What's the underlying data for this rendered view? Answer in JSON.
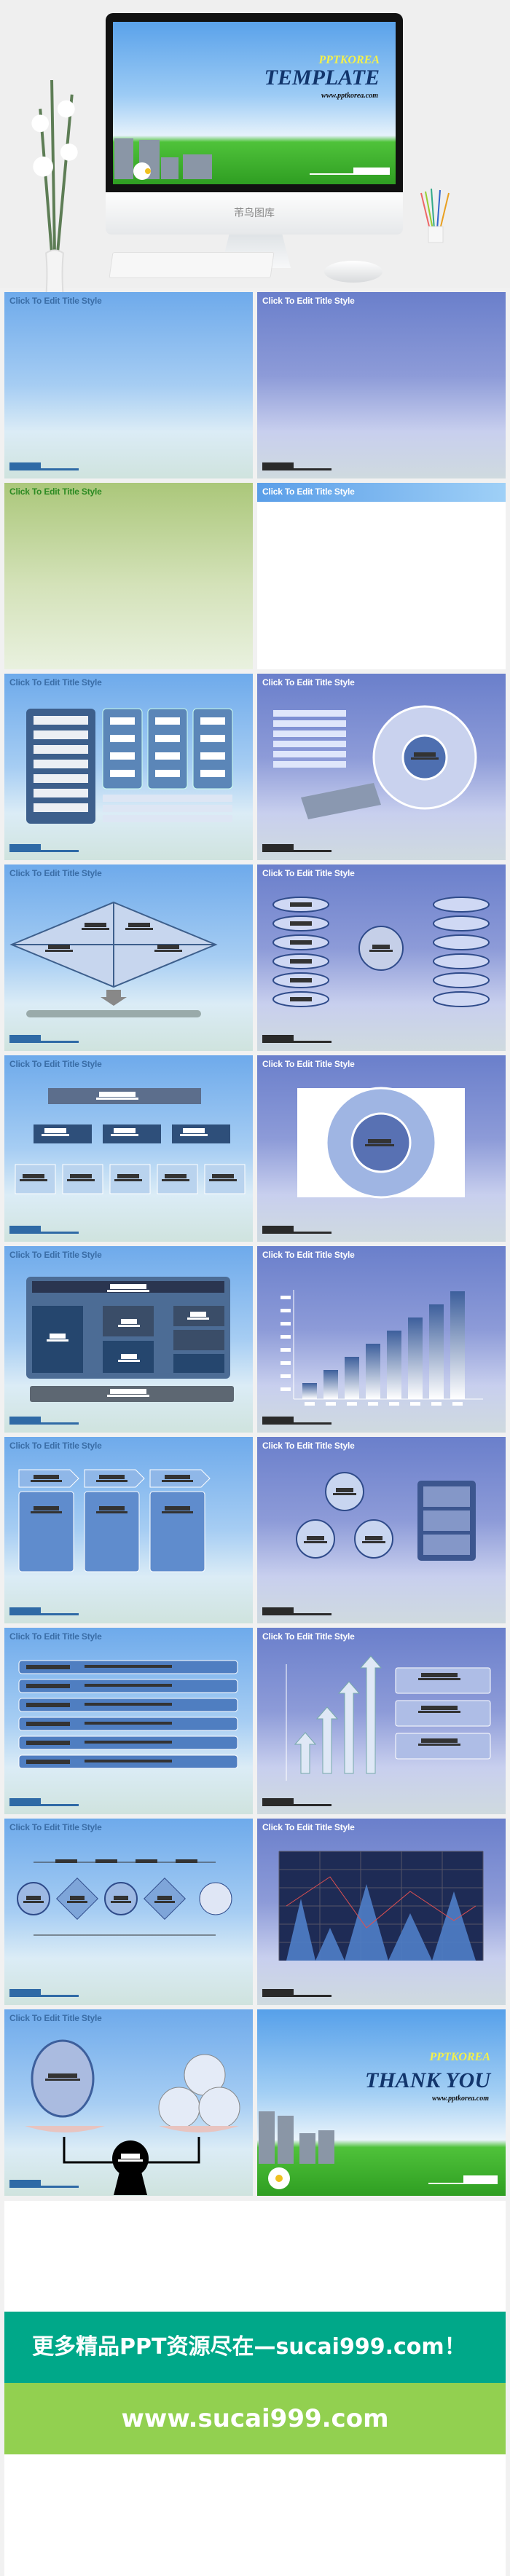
{
  "hero": {
    "screen": {
      "brand": "PPTKOREA",
      "title": "TEMPLATE",
      "url": "www.pptkorea.com"
    },
    "monitor_label": "芾鸟图库"
  },
  "slides": [
    {
      "title": "Click To Edit Title Style",
      "bg": "blue",
      "layout": "blank"
    },
    {
      "title": "Click To Edit Title Style",
      "bg": "purple",
      "layout": "blank"
    },
    {
      "title": "Click To Edit Title Style",
      "bg": "green",
      "layout": "blank"
    },
    {
      "title": "Click To Edit Title Style",
      "bg": "white",
      "layout": "blank"
    },
    {
      "title": "Click To Edit Title Style",
      "bg": "blue",
      "layout": "columns"
    },
    {
      "title": "Click To Edit Title Style",
      "bg": "purple",
      "layout": "spiral"
    },
    {
      "title": "Click To Edit Title Style",
      "bg": "blue",
      "layout": "diamond"
    },
    {
      "title": "Click To Edit Title Style",
      "bg": "purple",
      "layout": "pills"
    },
    {
      "title": "Click To Edit Title Style",
      "bg": "blue",
      "layout": "org"
    },
    {
      "title": "Click To Edit Title Style",
      "bg": "purple",
      "layout": "ring"
    },
    {
      "title": "Click To Edit Title Style",
      "bg": "blue",
      "layout": "panel"
    },
    {
      "title": "Click To Edit Title Style",
      "bg": "purple",
      "layout": "bars"
    },
    {
      "title": "Click To Edit Title Style",
      "bg": "blue",
      "layout": "arrows"
    },
    {
      "title": "Click To Edit Title Style",
      "bg": "purple",
      "layout": "cycle"
    },
    {
      "title": "Click To Edit Title Style",
      "bg": "blue",
      "layout": "rows"
    },
    {
      "title": "Click To Edit Title Style",
      "bg": "purple",
      "layout": "uparrows"
    },
    {
      "title": "Click To Edit Title Style",
      "bg": "blue",
      "layout": "flow"
    },
    {
      "title": "Click To Edit Title Style",
      "bg": "purple",
      "layout": "grid"
    },
    {
      "title": "Click To Edit Title Style",
      "bg": "blue",
      "layout": "scale"
    },
    {
      "title": "",
      "bg": "thanks",
      "layout": "thanks",
      "brand": "PPTKOREA",
      "heading": "THANK YOU",
      "url": "www.pptkorea.com"
    }
  ],
  "banner": {
    "promo": "更多精品PPT资源尽在—sucai999.com！",
    "site": "www.sucai999.com"
  },
  "colors": {
    "teal": "#00a889",
    "green": "#92d050",
    "slide_blue": "#6eaaeb",
    "slide_purple": "#6a7fcb"
  }
}
